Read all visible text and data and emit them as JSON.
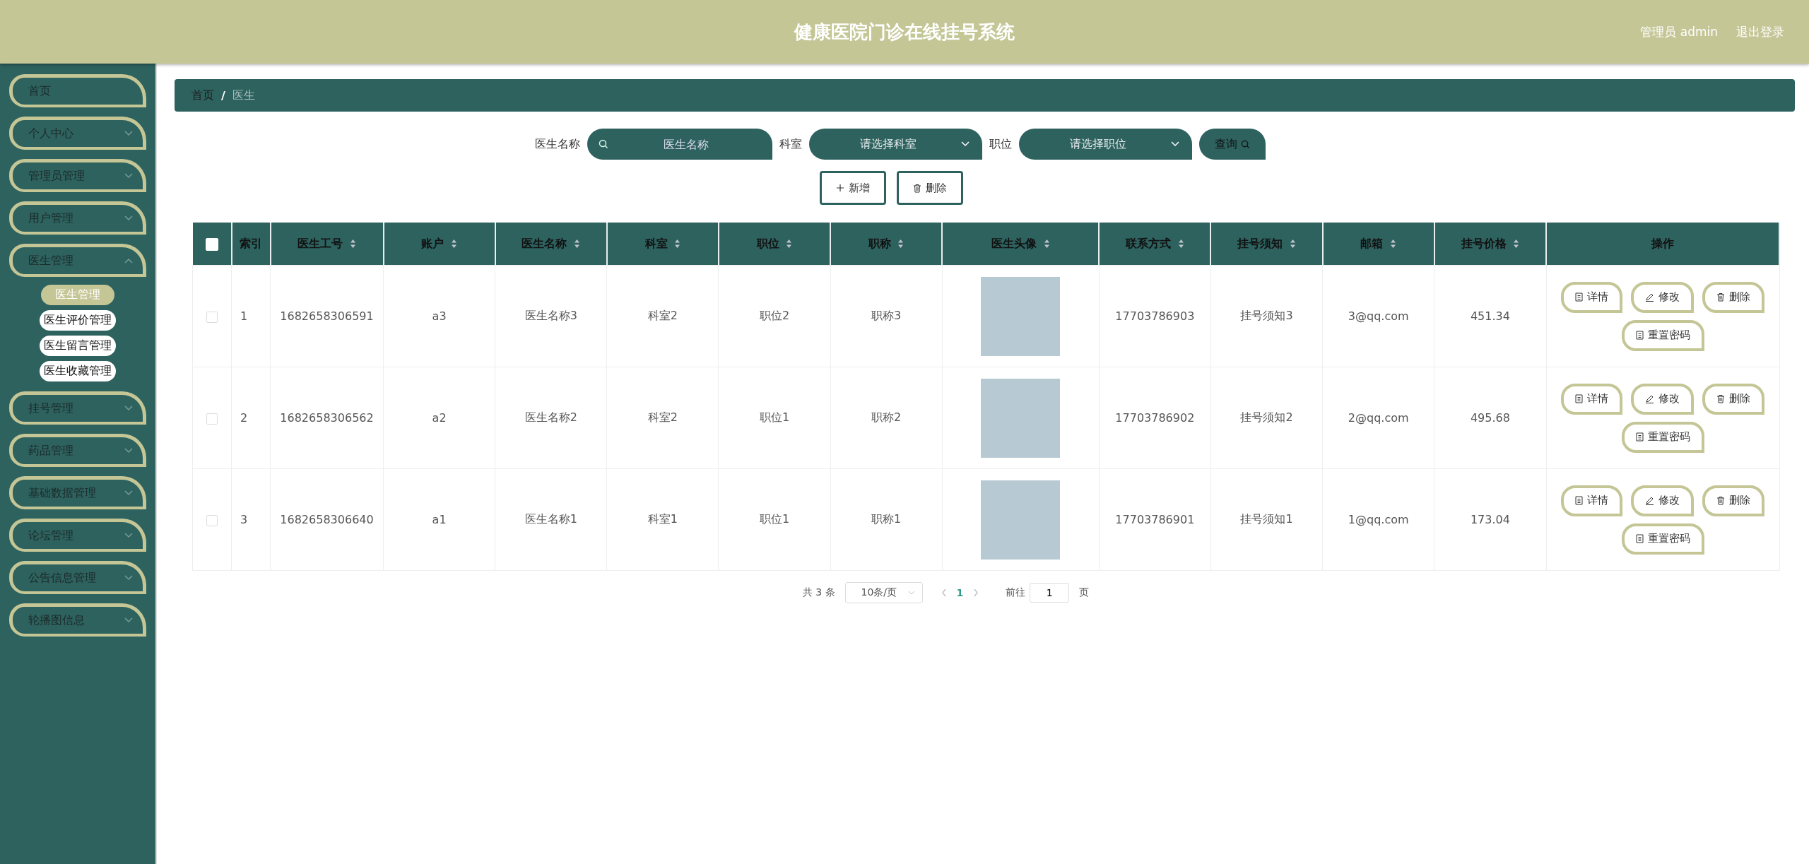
{
  "header": {
    "title": "健康医院门诊在线挂号系统",
    "user": "管理员 admin",
    "logout": "退出登录"
  },
  "sidebar": {
    "items": [
      {
        "label": "首页",
        "kind": "link"
      },
      {
        "label": "个人中心",
        "kind": "menu",
        "expanded": false
      },
      {
        "label": "管理员管理",
        "kind": "menu",
        "expanded": false
      },
      {
        "label": "用户管理",
        "kind": "menu",
        "expanded": false
      },
      {
        "label": "医生管理",
        "kind": "menu",
        "expanded": true,
        "children": [
          {
            "label": "医生管理",
            "selected": true
          },
          {
            "label": "医生评价管理",
            "selected": false
          },
          {
            "label": "医生留言管理",
            "selected": false
          },
          {
            "label": "医生收藏管理",
            "selected": false
          }
        ]
      },
      {
        "label": "挂号管理",
        "kind": "menu",
        "expanded": false
      },
      {
        "label": "药品管理",
        "kind": "menu",
        "expanded": false
      },
      {
        "label": "基础数据管理",
        "kind": "menu",
        "expanded": false
      },
      {
        "label": "论坛管理",
        "kind": "menu",
        "expanded": false
      },
      {
        "label": "公告信息管理",
        "kind": "menu",
        "expanded": false
      },
      {
        "label": "轮播图信息",
        "kind": "menu",
        "expanded": false
      }
    ]
  },
  "breadcrumb": {
    "separator": "/",
    "items": [
      "首页",
      "医生"
    ]
  },
  "search": {
    "fields": [
      {
        "label": "医生名称",
        "kind": "input",
        "placeholder": "医生名称"
      },
      {
        "label": "科室",
        "kind": "select",
        "placeholder": "请选择科室"
      },
      {
        "label": "职位",
        "kind": "select",
        "placeholder": "请选择职位"
      }
    ],
    "button": "查询"
  },
  "actions": [
    {
      "label": "新增",
      "kind": "add"
    },
    {
      "label": "删除",
      "kind": "delete"
    }
  ],
  "table": {
    "select_all": false,
    "columns": [
      {
        "label": "索引",
        "sortable": false
      },
      {
        "label": "医生工号",
        "sortable": true
      },
      {
        "label": "账户",
        "sortable": true
      },
      {
        "label": "医生名称",
        "sortable": true
      },
      {
        "label": "科室",
        "sortable": true
      },
      {
        "label": "职位",
        "sortable": true
      },
      {
        "label": "职称",
        "sortable": true
      },
      {
        "label": "医生头像",
        "sortable": true
      },
      {
        "label": "联系方式",
        "sortable": true
      },
      {
        "label": "挂号须知",
        "sortable": true
      },
      {
        "label": "邮箱",
        "sortable": true
      },
      {
        "label": "挂号价格",
        "sortable": true
      },
      {
        "label": "操作",
        "sortable": false
      }
    ],
    "rows": [
      {
        "checked": false,
        "cells": [
          "1",
          "1682658306591",
          "a3",
          "医生名称3",
          "科室2",
          "职位2",
          "职称3",
          null,
          "17703786903",
          "挂号须知3",
          "3@qq.com",
          "451.34"
        ],
        "actions": [
          {
            "label": "详情",
            "kind": "detail"
          },
          {
            "label": "修改",
            "kind": "edit"
          },
          {
            "label": "删除",
            "kind": "delete"
          },
          {
            "label": "重置密码",
            "kind": "detail"
          }
        ]
      },
      {
        "checked": false,
        "cells": [
          "2",
          "1682658306562",
          "a2",
          "医生名称2",
          "科室2",
          "职位1",
          "职称2",
          null,
          "17703786902",
          "挂号须知2",
          "2@qq.com",
          "495.68"
        ],
        "actions": [
          {
            "label": "详情",
            "kind": "detail"
          },
          {
            "label": "修改",
            "kind": "edit"
          },
          {
            "label": "删除",
            "kind": "delete"
          },
          {
            "label": "重置密码",
            "kind": "detail"
          }
        ]
      },
      {
        "checked": false,
        "cells": [
          "3",
          "1682658306640",
          "a1",
          "医生名称1",
          "科室1",
          "职位1",
          "职称1",
          null,
          "17703786901",
          "挂号须知1",
          "1@qq.com",
          "173.04"
        ],
        "actions": [
          {
            "label": "详情",
            "kind": "detail"
          },
          {
            "label": "修改",
            "kind": "edit"
          },
          {
            "label": "删除",
            "kind": "delete"
          },
          {
            "label": "重置密码",
            "kind": "detail"
          }
        ]
      }
    ]
  },
  "pagination": {
    "total": "共 3 条",
    "page_size": "10条/页",
    "pages": [
      {
        "label": "1",
        "selected": true
      }
    ],
    "goto_label": "前往",
    "goto_value": "1",
    "goto_suffix": "页"
  }
}
